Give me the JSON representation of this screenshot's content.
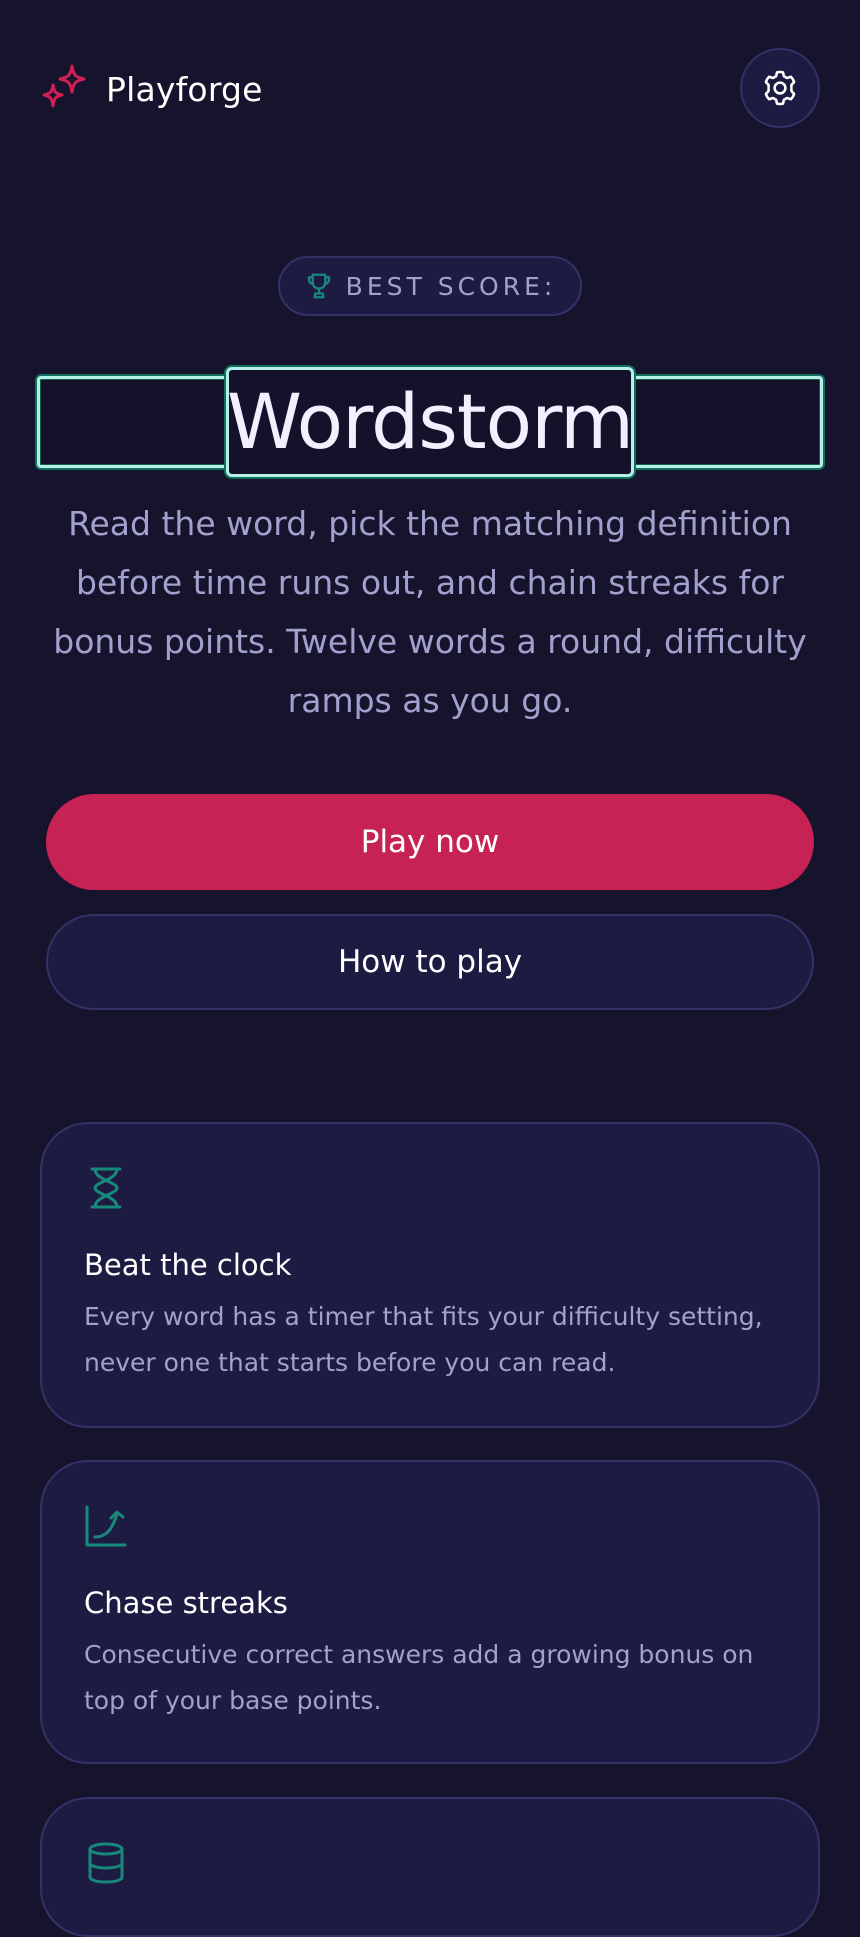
{
  "app": {
    "name": "Playforge",
    "icons": {
      "logo": "sparkle-icon",
      "settings": "gear-icon"
    }
  },
  "hero": {
    "best_score_label": "BEST SCORE:",
    "best_score_icon": "trophy-icon",
    "title": "Wordstorm",
    "description": "Read the word, pick the matching definition before time runs out, and chain streaks for bonus points. Twelve words a round, difficulty ramps as you go."
  },
  "actions": {
    "play_label": "Play now",
    "how_label": "How to play"
  },
  "features": [
    {
      "icon": "hourglass-icon",
      "title": "Beat the clock",
      "desc": "Every word has a timer that fits your difficulty setting, never one that starts before you can read."
    },
    {
      "icon": "trend-up-icon",
      "title": "Chase streaks",
      "desc": "Consecutive correct answers add a growing bonus on top of your base points."
    },
    {
      "icon": "database-icon"
    }
  ],
  "colors": {
    "background": "#16132d",
    "surface": "#1e1b42",
    "border": "#353066",
    "primary": "#c62253",
    "accent_teal": "#17897a",
    "text_muted": "#a4a0ce",
    "logo_pink": "#d21f55"
  }
}
